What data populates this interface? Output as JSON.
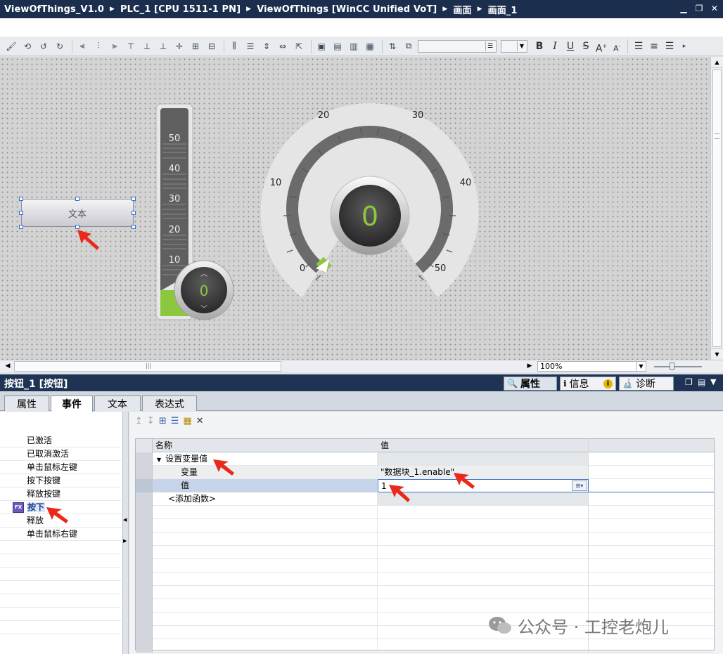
{
  "titlebar": {
    "crumbs": [
      "ViewOfThings_V1.0",
      "PLC_1 [CPU 1511-1 PN]",
      "ViewOfThings [WinCC Unified VoT]",
      "画面",
      "画面_1"
    ]
  },
  "canvas": {
    "button_label": "文本",
    "slider": {
      "ticks": [
        "50",
        "40",
        "30",
        "20",
        "10"
      ],
      "value": "0"
    },
    "gauge": {
      "ticks": [
        "0",
        "10",
        "20",
        "30",
        "40",
        "50"
      ],
      "value": "0"
    }
  },
  "statusbar": {
    "zoom": "100%"
  },
  "panel": {
    "title": "按钮_1 [按钮]",
    "right_tabs": [
      "属性",
      "信息",
      "诊断"
    ],
    "tabs": [
      "属性",
      "事件",
      "文本",
      "表达式"
    ],
    "events": [
      "已激活",
      "已取消激活",
      "单击鼠标左键",
      "按下按键",
      "释放按键",
      "按下",
      "释放",
      "单击鼠标右键"
    ],
    "columns": {
      "name": "名称",
      "value": "值"
    },
    "function_name": "设置变量值",
    "param_variable": "变量",
    "param_variable_value": "\"数据块_1.enable\"",
    "param_value": "值",
    "param_value_value": "1",
    "add_function": "<添加函数>"
  },
  "watermark": "公众号 · 工控老炮儿",
  "colors": {
    "accent_green": "#8dc63f",
    "title_bg": "#1b2e4e",
    "annotation_red": "#e8291c"
  }
}
